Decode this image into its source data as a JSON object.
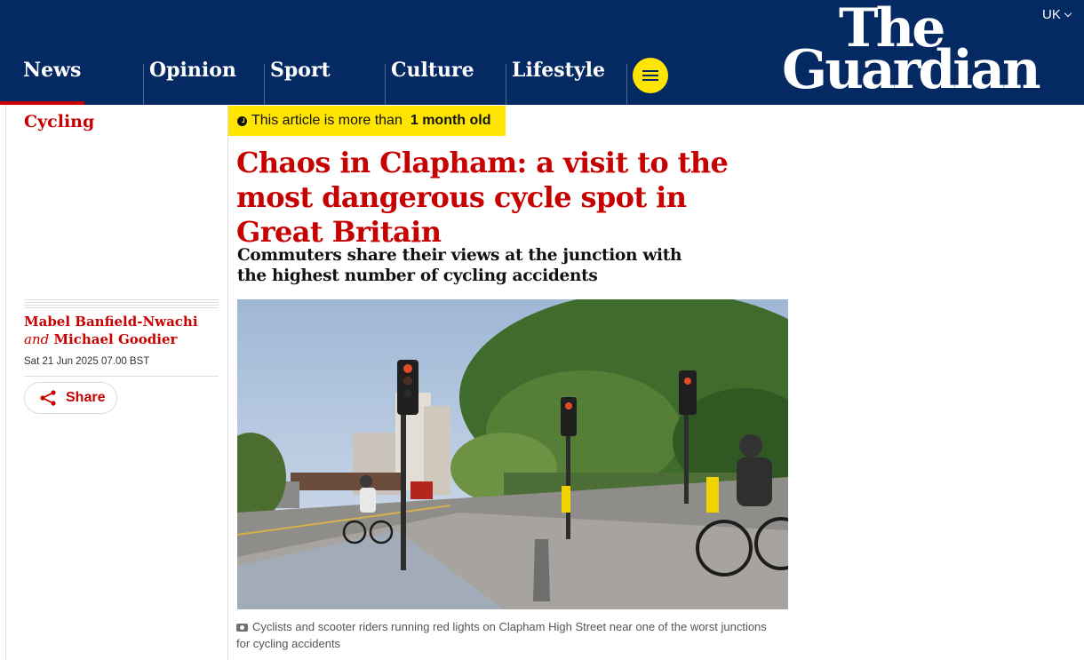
{
  "edition": {
    "label": "UK"
  },
  "logo": {
    "line1": "The",
    "line2": "Guardian"
  },
  "nav": {
    "items": [
      {
        "label": "News",
        "active": true
      },
      {
        "label": "Opinion"
      },
      {
        "label": "Sport"
      },
      {
        "label": "Culture"
      },
      {
        "label": "Lifestyle"
      }
    ]
  },
  "article": {
    "section": "Cycling",
    "age_prefix": "This article is more than",
    "age_value": "1 month old",
    "headline": "Chaos in Clapham: a visit to the most dangerous cycle spot in Great Britain",
    "standfirst": "Commuters share their views at the junction with the highest number of cycling accidents",
    "authors": [
      "Mabel Banfield-Nwachi",
      "Michael Goodier"
    ],
    "author_joiner": "and",
    "date": "Sat 21 Jun 2025 07.00 BST",
    "share_label": "Share",
    "caption": "Cyclists and scooter riders running red lights on Clapham High Street near one of the worst junctions for cycling accidents"
  },
  "colors": {
    "brand_blue": "#052962",
    "news_red": "#c70000",
    "highlight_yellow": "#ffe500"
  },
  "icons": {
    "menu": "hamburger-menu-icon",
    "share": "share-icon",
    "clock": "clock-icon",
    "camera": "camera-icon"
  }
}
